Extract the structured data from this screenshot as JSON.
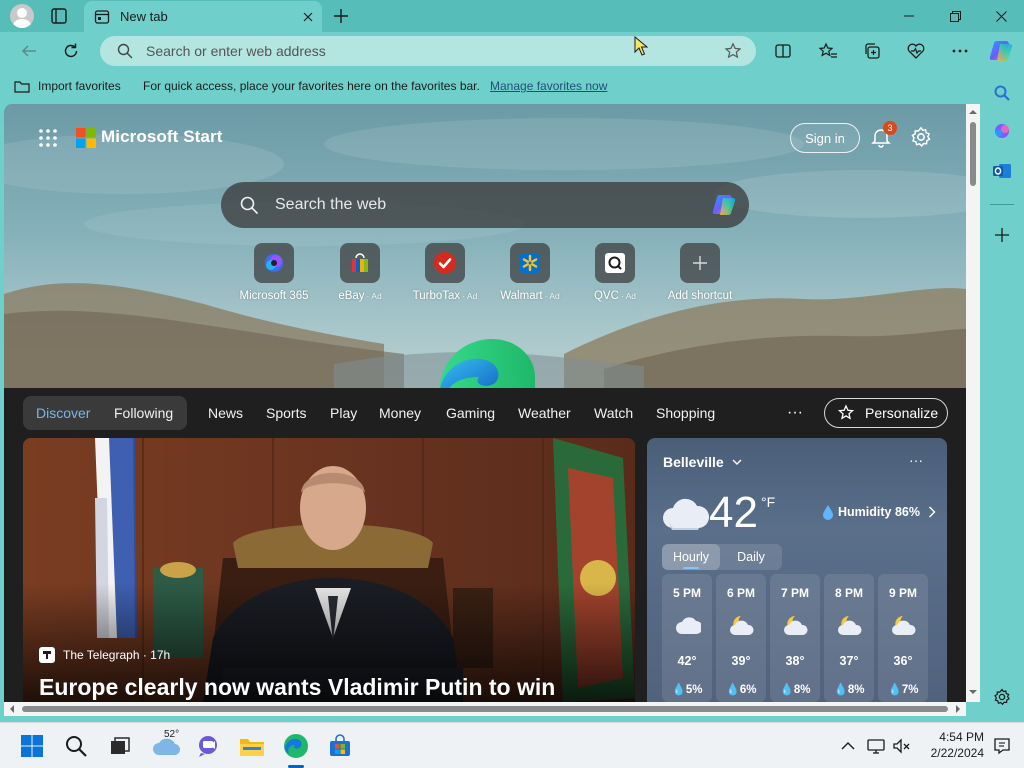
{
  "browser": {
    "tab_title": "New tab",
    "omnibox_placeholder": "Search or enter web address"
  },
  "favorites_bar": {
    "import_label": "Import favorites",
    "message": "For quick access, place your favorites here on the favorites bar.",
    "manage_link": "Manage favorites now"
  },
  "start_page": {
    "brand": "Microsoft Start",
    "sign_in": "Sign in",
    "notification_count": "3",
    "search_placeholder": "Search the web",
    "shortcuts": [
      {
        "label": "Microsoft 365",
        "ad": ""
      },
      {
        "label": "eBay",
        "ad": "· Ad"
      },
      {
        "label": "TurboTax",
        "ad": "· Ad"
      },
      {
        "label": "Walmart",
        "ad": "· Ad"
      },
      {
        "label": "QVC",
        "ad": "· Ad"
      },
      {
        "label": "Add shortcut",
        "ad": ""
      }
    ]
  },
  "feed": {
    "nav": [
      "Discover",
      "Following",
      "News",
      "Sports",
      "Play",
      "Money",
      "Gaming",
      "Weather",
      "Watch",
      "Shopping"
    ],
    "more": "···",
    "personalize": "Personalize",
    "hero": {
      "source": "The Telegraph · 17h",
      "headline": "Europe clearly now wants Vladimir Putin to win"
    }
  },
  "weather": {
    "city": "Belleville",
    "more": "···",
    "temperature": "42",
    "unit": "°F",
    "humidity": "Humidity 86%",
    "tabs": [
      "Hourly",
      "Daily"
    ],
    "hours": [
      {
        "time": "5 PM",
        "icon": "cloudy-icon",
        "temp": "42°",
        "precip": "5%"
      },
      {
        "time": "6 PM",
        "icon": "partly-cloudy-night-icon",
        "temp": "39°",
        "precip": "6%"
      },
      {
        "time": "7 PM",
        "icon": "partly-cloudy-night-icon",
        "temp": "38°",
        "precip": "8%"
      },
      {
        "time": "8 PM",
        "icon": "partly-cloudy-night-icon",
        "temp": "37°",
        "precip": "8%"
      },
      {
        "time": "9 PM",
        "icon": "partly-cloudy-night-icon",
        "temp": "36°",
        "precip": "7%"
      }
    ]
  },
  "taskbar": {
    "weather_temp": "52°",
    "time": "4:54 PM",
    "date": "2/22/2024"
  },
  "colors": {
    "browser_frame": "#6fd0cb",
    "titlebar": "#57bdb8",
    "accent_nav": "#7cb4ee",
    "feed_bg": "#1f1f1f"
  }
}
